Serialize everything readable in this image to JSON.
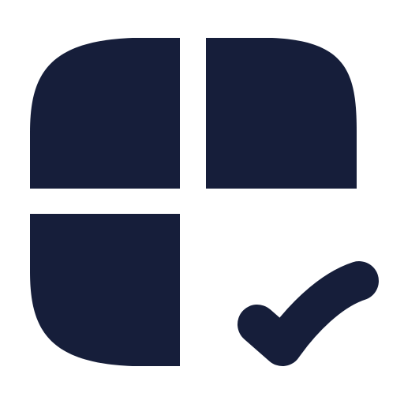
{
  "icon": {
    "name": "table-check-icon",
    "color": "#161E3A",
    "background": "#FFFFFF"
  }
}
